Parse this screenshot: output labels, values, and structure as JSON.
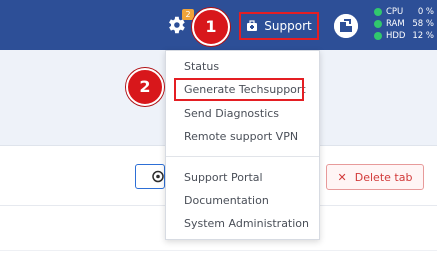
{
  "topbar": {
    "notification_count": "2",
    "support_label": "Support",
    "stats": [
      {
        "name": "CPU",
        "value": "0 %"
      },
      {
        "name": "RAM",
        "value": "58 %"
      },
      {
        "name": "HDD",
        "value": "12 %"
      }
    ]
  },
  "callouts": [
    "1",
    "2"
  ],
  "support_menu": {
    "items": [
      "Status",
      "Generate Techsupport",
      "Send Diagnostics",
      "Remote support VPN",
      "Support Portal",
      "Documentation",
      "System Administration"
    ]
  },
  "toolbar": {
    "delete_tab_label": "Delete tab"
  },
  "colors": {
    "topbar": "#2d4f97",
    "highlight": "#e41e23",
    "status_ok": "#31c86d",
    "delete": "#d23a3a"
  }
}
